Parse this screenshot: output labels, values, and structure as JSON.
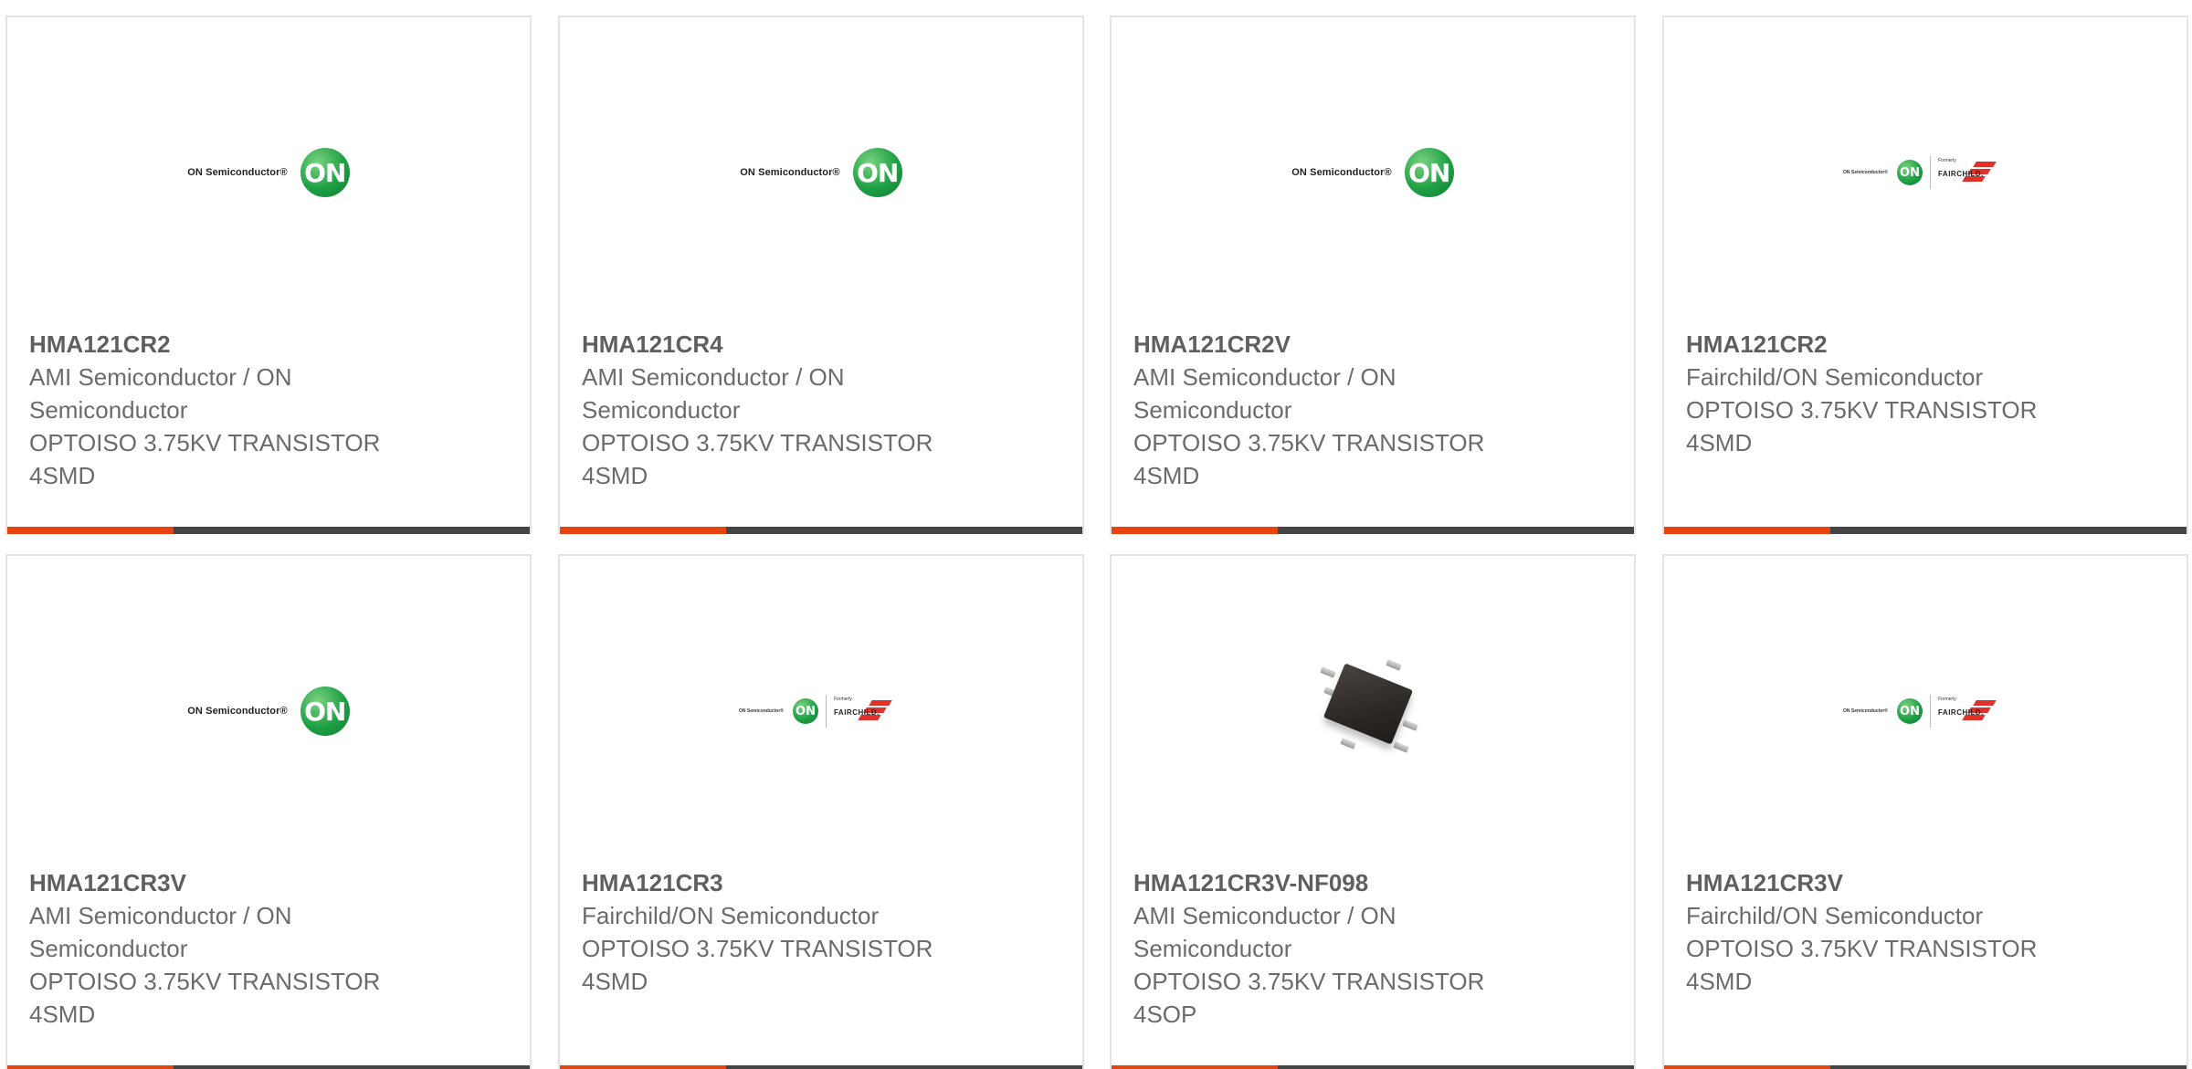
{
  "products": [
    {
      "part": "HMA121CR2",
      "manufacturer": "AMI Semiconductor / ON Semiconductor",
      "manufacturer_lines": [
        "AMI Semiconductor / ON",
        "Semiconductor"
      ],
      "description": "OPTOISO 3.75KV TRANSISTOR 4SMD",
      "description_lines": [
        "OPTOISO 3.75KV TRANSISTOR",
        "4SMD"
      ],
      "logo": "on-semiconductor-logo",
      "logo_text": "ON Semiconductor®",
      "logo_mark": "ON"
    },
    {
      "part": "HMA121CR4",
      "manufacturer": "AMI Semiconductor / ON Semiconductor",
      "manufacturer_lines": [
        "AMI Semiconductor / ON",
        "Semiconductor"
      ],
      "description": "OPTOISO 3.75KV TRANSISTOR 4SMD",
      "description_lines": [
        "OPTOISO 3.75KV TRANSISTOR",
        "4SMD"
      ],
      "logo": "on-semiconductor-logo",
      "logo_text": "ON Semiconductor®",
      "logo_mark": "ON"
    },
    {
      "part": "HMA121CR2V",
      "manufacturer": "AMI Semiconductor / ON Semiconductor",
      "manufacturer_lines": [
        "AMI Semiconductor / ON",
        "Semiconductor"
      ],
      "description": "OPTOISO 3.75KV TRANSISTOR 4SMD",
      "description_lines": [
        "OPTOISO 3.75KV TRANSISTOR",
        "4SMD"
      ],
      "logo": "on-semiconductor-logo",
      "logo_text": "ON Semiconductor®",
      "logo_mark": "ON"
    },
    {
      "part": "HMA121CR2",
      "manufacturer": "Fairchild/ON Semiconductor",
      "manufacturer_lines": [
        "Fairchild/ON Semiconductor"
      ],
      "description": "OPTOISO 3.75KV TRANSISTOR 4SMD",
      "description_lines": [
        "OPTOISO 3.75KV TRANSISTOR",
        "4SMD"
      ],
      "logo": "on-fairchild-logo",
      "logo_text": "ON Semiconductor®",
      "logo_mark": "ON",
      "logo_formerly": "Formerly",
      "logo_fairchild": "FAIRCHILD."
    },
    {
      "part": "HMA121CR3V",
      "manufacturer": "AMI Semiconductor / ON Semiconductor",
      "manufacturer_lines": [
        "AMI Semiconductor / ON",
        "Semiconductor"
      ],
      "description": "OPTOISO 3.75KV TRANSISTOR 4SMD",
      "description_lines": [
        "OPTOISO 3.75KV TRANSISTOR",
        "4SMD"
      ],
      "logo": "on-semiconductor-logo",
      "logo_text": "ON Semiconductor®",
      "logo_mark": "ON"
    },
    {
      "part": "HMA121CR3",
      "manufacturer": "Fairchild/ON Semiconductor",
      "manufacturer_lines": [
        "Fairchild/ON Semiconductor"
      ],
      "description": "OPTOISO 3.75KV TRANSISTOR 4SMD",
      "description_lines": [
        "OPTOISO 3.75KV TRANSISTOR",
        "4SMD"
      ],
      "logo": "on-fairchild-logo",
      "logo_text": "ON Semiconductor®",
      "logo_mark": "ON",
      "logo_formerly": "Formerly",
      "logo_fairchild": "FAIRCHILD."
    },
    {
      "part": "HMA121CR3V-NF098",
      "manufacturer": "AMI Semiconductor / ON Semiconductor",
      "manufacturer_lines": [
        "AMI Semiconductor / ON",
        "Semiconductor"
      ],
      "description": "OPTOISO 3.75KV TRANSISTOR 4SOP",
      "description_lines": [
        "OPTOISO 3.75KV TRANSISTOR",
        "4SOP"
      ],
      "logo": "chip-photo"
    },
    {
      "part": "HMA121CR3V",
      "manufacturer": "Fairchild/ON Semiconductor",
      "manufacturer_lines": [
        "Fairchild/ON Semiconductor"
      ],
      "description": "OPTOISO 3.75KV TRANSISTOR 4SMD",
      "description_lines": [
        "OPTOISO 3.75KV TRANSISTOR",
        "4SMD"
      ],
      "logo": "on-fairchild-logo",
      "logo_text": "ON Semiconductor®",
      "logo_mark": "ON",
      "logo_formerly": "Formerly",
      "logo_fairchild": "FAIRCHILD."
    }
  ],
  "colors": {
    "accent": "#e8430f",
    "bar": "#444444",
    "text": "#6b6b6b",
    "border": "#e3e3e3"
  }
}
